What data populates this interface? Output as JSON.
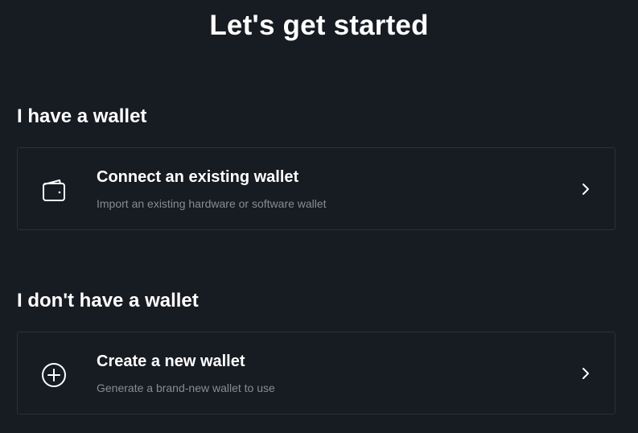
{
  "header": {
    "title": "Let's get started"
  },
  "sections": [
    {
      "heading": "I have a wallet",
      "card": {
        "icon": "wallet-icon",
        "title": "Connect an existing wallet",
        "subtitle": "Import an existing hardware or software wallet"
      }
    },
    {
      "heading": "I don't have a wallet",
      "card": {
        "icon": "plus-circle-icon",
        "title": "Create a new wallet",
        "subtitle": "Generate a brand-new wallet to use"
      }
    }
  ],
  "colors": {
    "background": "#171b22",
    "card_border": "#2c313a",
    "text_primary": "#ffffff",
    "text_secondary": "#868c96"
  }
}
